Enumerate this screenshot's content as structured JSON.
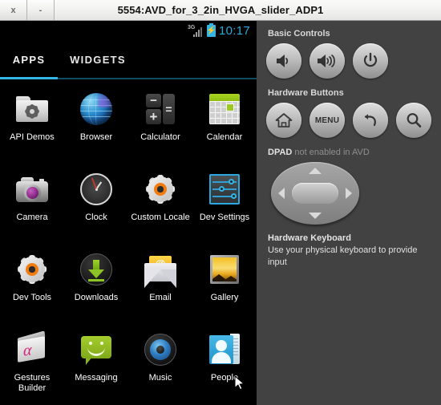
{
  "window": {
    "title": "5554:AVD_for_3_2in_HVGA_slider_ADP1",
    "close_label": "x",
    "minimize_label": "-"
  },
  "device": {
    "statusbar": {
      "network_label": "3G",
      "battery_icon": "battery-charging-icon",
      "signal_icon": "signal-bars-icon",
      "time": "10:17"
    },
    "tabs": [
      {
        "label": "APPS",
        "active": true
      },
      {
        "label": "WIDGETS",
        "active": false
      }
    ],
    "apps": [
      {
        "label": "API Demos",
        "icon": "api-demos-icon"
      },
      {
        "label": "Browser",
        "icon": "browser-icon"
      },
      {
        "label": "Calculator",
        "icon": "calculator-icon"
      },
      {
        "label": "Calendar",
        "icon": "calendar-icon"
      },
      {
        "label": "Camera",
        "icon": "camera-icon"
      },
      {
        "label": "Clock",
        "icon": "clock-icon"
      },
      {
        "label": "Custom Locale",
        "icon": "custom-locale-icon"
      },
      {
        "label": "Dev Settings",
        "icon": "dev-settings-icon"
      },
      {
        "label": "Dev Tools",
        "icon": "dev-tools-icon"
      },
      {
        "label": "Downloads",
        "icon": "downloads-icon"
      },
      {
        "label": "Email",
        "icon": "email-icon"
      },
      {
        "label": "Gallery",
        "icon": "gallery-icon"
      },
      {
        "label": "Gestures Builder",
        "icon": "gestures-builder-icon"
      },
      {
        "label": "Messaging",
        "icon": "messaging-icon"
      },
      {
        "label": "Music",
        "icon": "music-icon"
      },
      {
        "label": "People",
        "icon": "people-icon"
      }
    ],
    "email_icon_glyph": "@"
  },
  "panel": {
    "basic_controls_heading": "Basic Controls",
    "basic_controls": [
      {
        "name": "volume-down-button",
        "label": ""
      },
      {
        "name": "volume-up-button",
        "label": ""
      },
      {
        "name": "power-button",
        "label": ""
      }
    ],
    "hardware_buttons_heading": "Hardware Buttons",
    "hardware_buttons": [
      {
        "name": "home-button",
        "label": ""
      },
      {
        "name": "menu-button",
        "label": "MENU"
      },
      {
        "name": "back-button",
        "label": ""
      },
      {
        "name": "search-button",
        "label": ""
      }
    ],
    "dpad_label": "DPAD",
    "dpad_status": " not enabled in AVD",
    "keyboard_title": "Hardware Keyboard",
    "keyboard_desc": "Use your physical keyboard to provide input"
  },
  "colors": {
    "accent_cyan": "#33b5e5",
    "panel_bg": "#424242",
    "device_bg": "#000000",
    "titlebar_bg": "#f1f1ef"
  }
}
